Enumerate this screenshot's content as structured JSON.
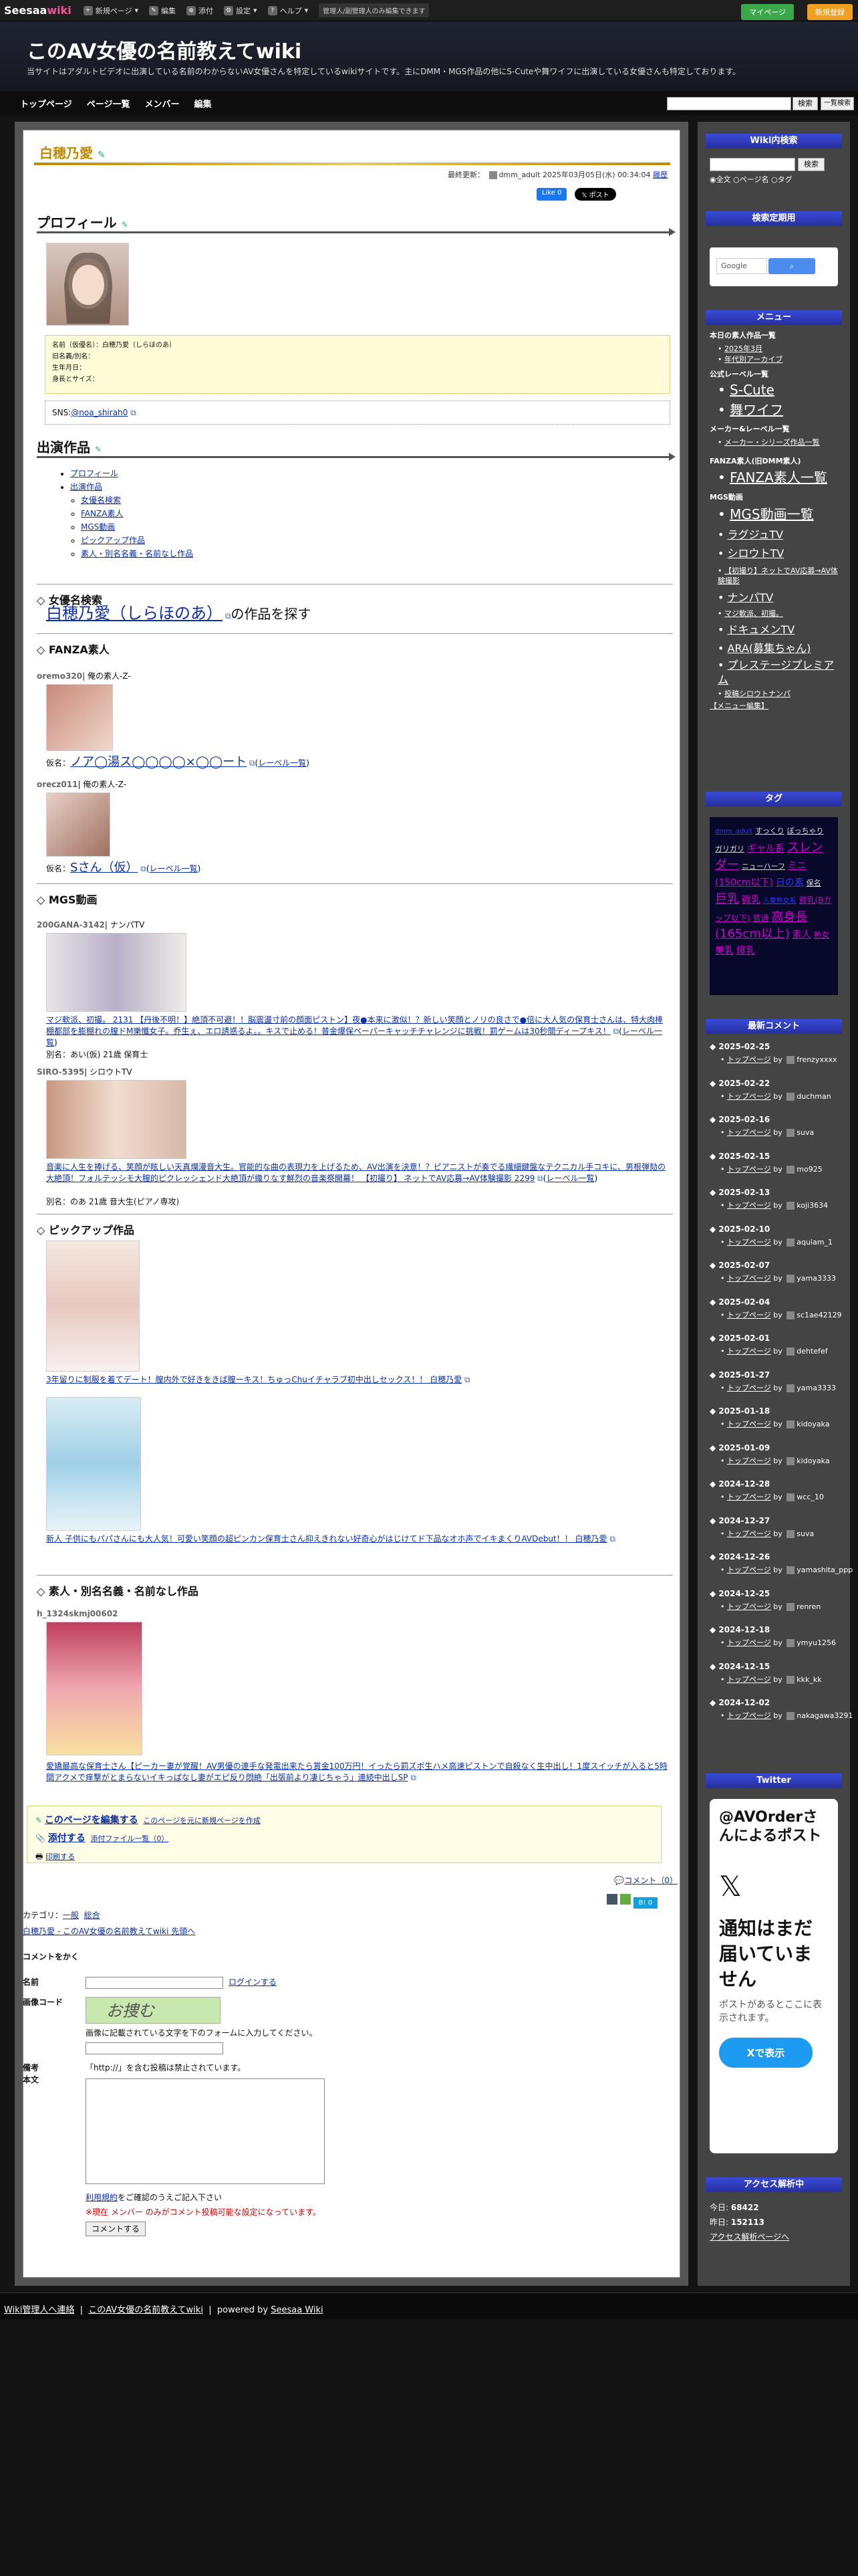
{
  "topbar": {
    "logo_a": "Seesaa",
    "logo_b": "wiki",
    "new_page": "新規ページ",
    "edit": "編集",
    "attach": "添付",
    "settings": "設定",
    "help": "ヘルプ",
    "admin_note": "管理人/副管理人のみ編集できます",
    "mypage": "マイページ",
    "signup": "新規登録"
  },
  "header": {
    "title": "このAV女優の名前教えてwiki",
    "desc": "当サイトはアダルトビデオに出演している名前のわからないAV女優さんを特定しているwikiサイトです。主にDMM・MGS作品の他にS-Cuteや舞ワイフに出演している女優さんも特定しております。"
  },
  "nav": {
    "items": [
      "トップページ",
      "ページ一覧",
      "メンバー",
      "編集"
    ],
    "search_btn": "検索",
    "ref_btn": "一覧検索"
  },
  "page": {
    "title": "白穂乃愛",
    "last_updated_label": "最終更新：",
    "last_updated_user": "dmm_adult",
    "last_updated_time": "2025年03月05日(水) 00:34:04",
    "history": "履歴",
    "fb_like": "Like 0",
    "x_post": "ポスト"
  },
  "profile": {
    "heading": "プロフィール",
    "name_line": "名前（仮優名）：白穂乃愛（しらほのあ）",
    "alias_line": "旧名義/別名：",
    "birth_line": "生年月日：",
    "size_line": "身長とサイズ：",
    "sns_label": "SNS:",
    "sns_handle": "@noa_shirah0"
  },
  "works": {
    "heading": "出演作品",
    "toc": [
      "プロフィール",
      "出演作品"
    ],
    "toc_sub": [
      "女優名検索",
      "FANZA素人",
      "MGS動画",
      "ピックアップ作品",
      "素人・別名名義・名前なし作品"
    ]
  },
  "search_section": {
    "heading": "◇ 女優名検索",
    "link": "白穂乃愛（しらほのあ）",
    "suffix": "の作品を探す"
  },
  "fanza": {
    "heading": "◇ FANZA素人",
    "item1_code": "oremo320",
    "item1_label": "| 俺の素人-Z-",
    "item1_name_label": "仮名：",
    "item1_name": "ノア◯湯ス◯◯◯◯×◯◯ート",
    "item1_label_link": "レーベル一覧",
    "item2_code": "orecz011",
    "item2_label": "| 俺の素人-Z-",
    "item2_name_label": "仮名：",
    "item2_name": "Sさん（仮）",
    "item2_label_link": "レーベル一覧"
  },
  "mgs": {
    "heading": "◇ MGS動画",
    "item1_code": "200GANA-3142",
    "item1_label": "| ナンパTV",
    "item1_title": "マジ軟派、初撮。 2131 【丹後不明！】絶頂不可避！！脳震盪寸前の顔面ピストン】夜●本来に激似！？新しい笑顔とノリの良さで●倍に大人気の保育士さんは、特大肉棒棚都部を膨棚れの膣ドM樂懺女子。乔生ぇ、エロ誘惑るよ。。キスで止める！普金爆保ペーパーキャッチチャレンジに挑戦！罰ゲームは30秒間ディープキス！",
    "item1_label_link": "レーベル一覧",
    "item1_alias": "別名：あい(仮) 21歳 保育士",
    "item2_code": "SIRO-5395",
    "item2_label": "| シロウトTV",
    "item2_title": "音楽に人生を捧げる、笑顔が眩しい天真爛漫音大生。官能的な曲の表現力を上げるため、AV出演を決意！？ピアニストが奏でる繊細鍵盤なテクニカル手コキに、男根弾劾の大絶頂！フォルテッシモ大膣的ピクレッシェンド大絶頂が織りなす鮮烈の音楽祭開幕！ 【初撮り】 ネットでAV応募→AV体験撮影 2299",
    "item2_label_link": "レーベル一覧",
    "item2_alias": "別名：のあ 21歳 音大生(ピアノ専攻)"
  },
  "pickup": {
    "heading": "◇ ピックアップ作品",
    "item1_title": "3年留りに制服を着てデート！膣内外で好きをきば膣ーキス！ちゅっChuイチャラブ初中出しセックス！！ 白穂乃愛",
    "item2_title": "新人 子供にもパパさんにも大人気！可愛い笑顔の超ピンカン保育士さん抑えきれない好奇心がはじけてド下品なオホ声でイキまくりAVDebut！！ 白穂乃愛"
  },
  "amateur": {
    "heading": "◇ 素人・別名名義・名前なし作品",
    "item1_code": "h_1324skmj00602",
    "item1_title": "愛嬌最高な保育士さん【ピーカー妻が覚醒！AV男優の連手な発電出来たら賞金100万円！イったら罰ズボ生ハメ高速ピストンで自殺なく生中出し！1度スイッチが入ると5時間アクメで痒撃がとまらないイキっぱなし妻がエピ反り悶絶「出張前より凄じちゃう」連続中出しSP"
  },
  "edit_box": {
    "edit_link": "このページを編集する",
    "copy_link": "このページを元に新規ページを作成",
    "attach_link": "添付する",
    "attach_list": "添付ファイル一覧（0）",
    "print_link": "印刷する"
  },
  "comments_meta": {
    "comment_count": "コメント（0）",
    "category_label": "カテゴリ：",
    "cat1": "一般",
    "cat2": "総合",
    "breadcrumb": "白穂乃愛 - このAV女優の名前教えてwiki 先頭へ",
    "tag_count": "0"
  },
  "comment_form": {
    "heading": "コメントをかく",
    "name_label": "名前",
    "login_link": "ログインする",
    "captcha_label": "画像コード",
    "captcha_text": "お捜む",
    "captcha_hint": "画像に記載されている文字を下のフォームに入力してください。",
    "note_label": "備考",
    "body_label": "本文",
    "http_note": "「http://」を含む投稿は禁止されています。",
    "terms_link": "利用規約",
    "terms_text": "をご確認のうえご記入下さい",
    "warning": "※現在 メンバー のみがコメント投稿可能な設定になっています。",
    "submit": "コメントする"
  },
  "sidebar": {
    "search_head": "Wiki内検索",
    "search_btn": "検索",
    "radio1": "全文",
    "radio2": "ページ名",
    "radio3": "タグ",
    "gsearch_head": "検索定期用",
    "google_label": "Google",
    "menu_head": "メニュー",
    "menu_s1": "本日の素人作品一覧",
    "menu_l1": "2025年3月",
    "menu_l2": "年代別アーカイブ",
    "menu_s2": "公式レーベル一覧",
    "menu_big1": "S-Cute",
    "menu_big2": "舞ワイフ",
    "menu_s3": "メーカー&レーベル一覧",
    "menu_l3": "メーカー・シリーズ作品一覧",
    "menu_s4": "FANZA素人(旧DMM素人)",
    "menu_big3": "FANZA素人一覧",
    "menu_s5": "MGS動画",
    "menu_big4": "MGS動画一覧",
    "menu_m1": "ラグジュTV",
    "menu_m2": "シロウトTV",
    "menu_m3": "【初撮り】ネットでAV応募→AV体験撮影",
    "menu_m4": "ナンパTV",
    "menu_m5": "マジ軟派、初撮。",
    "menu_m6": "ドキュメンTV",
    "menu_m7": "ARA(募集ちゃん)",
    "menu_m8": "プレステージプレミアム",
    "menu_m9": "投稿シロウトナンパ",
    "menu_edit": "【メニュー編集】",
    "tag_head": "タグ",
    "tags": [
      "dmm_adult",
      "すっくり",
      "ぽっちゃり",
      "ガリガリ",
      "ギャル系",
      "スレンダー",
      "ニューハーフ",
      "ミニ(150cm以下)",
      "日の素",
      "保名",
      "巨乳",
      "微乳",
      "人妻熟女系",
      "貧乳(Bカップ以下)",
      "普通",
      "高身長(165cm以上)",
      "素人",
      "熟女",
      "美乳",
      "爆乳"
    ],
    "recent_head": "最新コメント",
    "recent": [
      {
        "date": "2025-02-25",
        "page": "トップページ",
        "user": "frenzyxxxx"
      },
      {
        "date": "2025-02-22",
        "page": "トップページ",
        "user": "duchman"
      },
      {
        "date": "2025-02-16",
        "page": "トップページ",
        "user": "suva"
      },
      {
        "date": "2025-02-15",
        "page": "トップページ",
        "user": "mo925"
      },
      {
        "date": "2025-02-13",
        "page": "トップページ",
        "user": "koji3634"
      },
      {
        "date": "2025-02-10",
        "page": "トップページ",
        "user": "aquiam_1"
      },
      {
        "date": "2025-02-07",
        "page": "トップページ",
        "user": "yama3333"
      },
      {
        "date": "2025-02-04",
        "page": "トップページ",
        "user": "sc1ae42129"
      },
      {
        "date": "2025-02-01",
        "page": "トップページ",
        "user": "dehtefef"
      },
      {
        "date": "2025-01-27",
        "page": "トップページ",
        "user": "yama3333"
      },
      {
        "date": "2025-01-18",
        "page": "トップページ",
        "user": "kidoyaka"
      },
      {
        "date": "2025-01-09",
        "page": "トップページ",
        "user": "kidoyaka"
      },
      {
        "date": "2024-12-28",
        "page": "トップページ",
        "user": "wcc_10"
      },
      {
        "date": "2024-12-27",
        "page": "トップページ",
        "user": "suva"
      },
      {
        "date": "2024-12-26",
        "page": "トップページ",
        "user": "yamashita_ppp"
      },
      {
        "date": "2024-12-25",
        "page": "トップページ",
        "user": "renren"
      },
      {
        "date": "2024-12-18",
        "page": "トップページ",
        "user": "ymyu1256"
      },
      {
        "date": "2024-12-15",
        "page": "トップページ",
        "user": "kkk_kk"
      },
      {
        "date": "2024-12-02",
        "page": "トップページ",
        "user": "nakagawa3291"
      }
    ],
    "twitter_head": "Twitter",
    "tw_title": "@AVOrderさんによるポスト",
    "tw_body": "通知はまだ届いていません",
    "tw_sub": "ポストがあるとここに表示されます。",
    "tw_btn": "Xで表示",
    "access_head": "アクセス解析中",
    "today_label": "今日: ",
    "today_value": "68422",
    "yesterday_label": "昨日: ",
    "yesterday_value": "152113",
    "access_link": "アクセス解析ページへ"
  },
  "footer": {
    "admin_link": "Wiki管理人へ連絡",
    "site_link": "このAV女優の名前教えてwiki",
    "powered": "powered by",
    "seesaa": "Seesaa Wiki"
  }
}
